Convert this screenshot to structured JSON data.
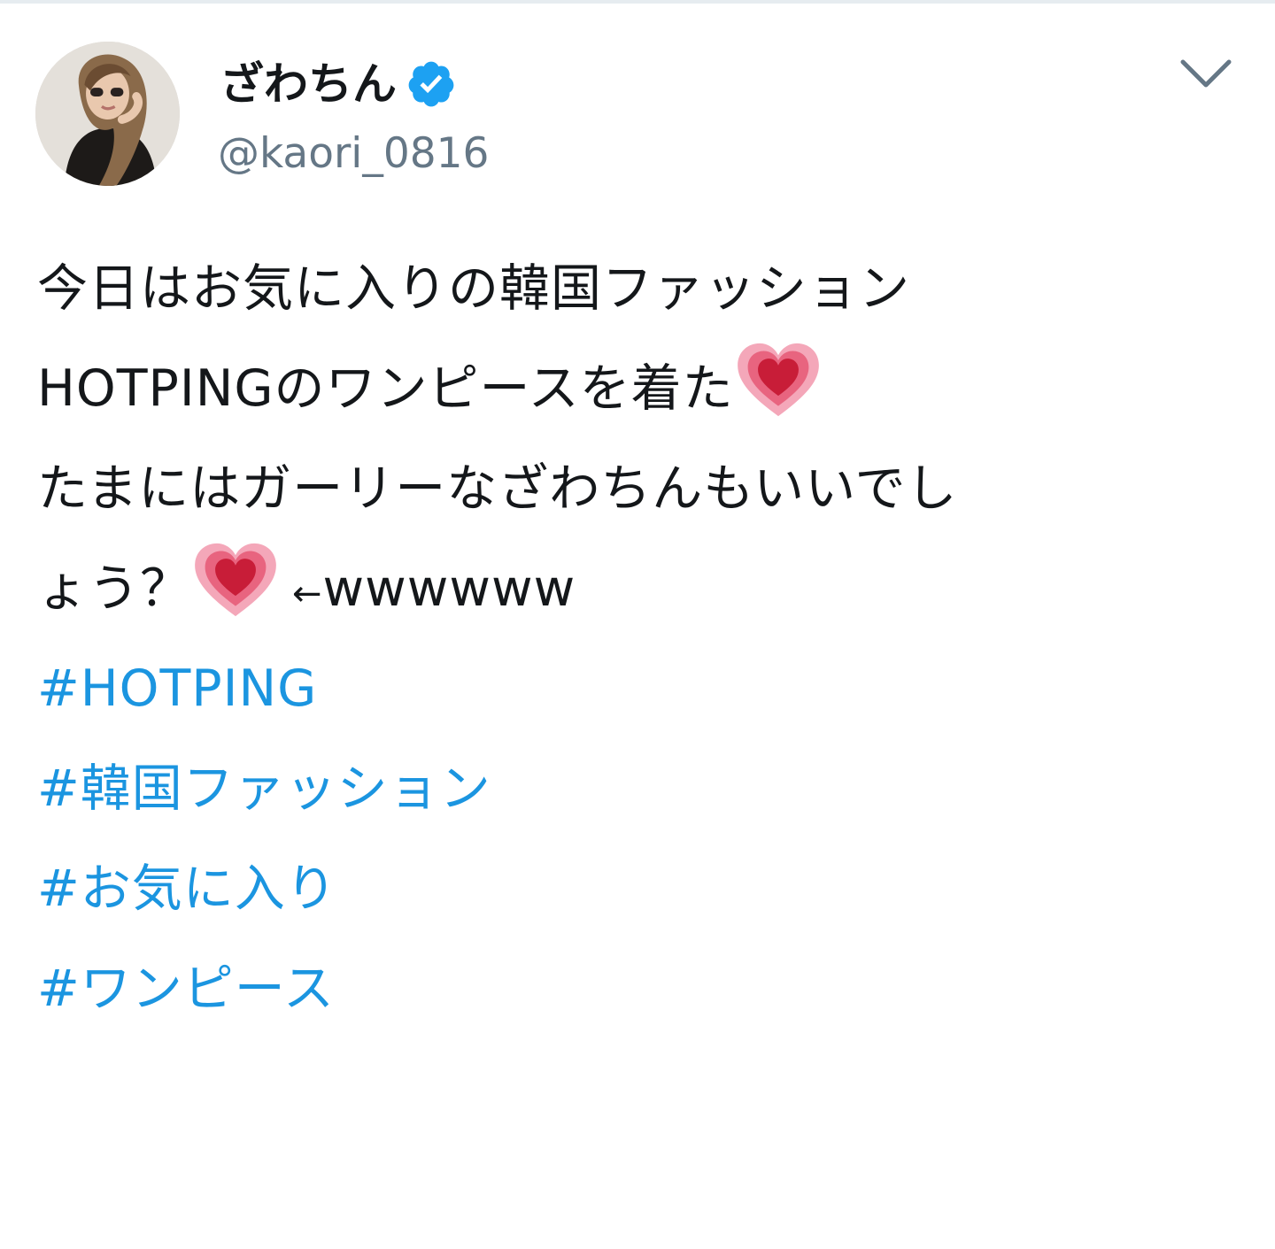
{
  "profile": {
    "display_name": "ざわちん",
    "handle": "@kaori_0816",
    "verified": true,
    "avatar_icon": "profile-photo"
  },
  "menu": {
    "icon": "chevron-down-icon"
  },
  "tweet": {
    "line1": "今日はお気に入りの韓国ファッション",
    "line2": "HOTPINGのワンピースを着た",
    "line3": "たまにはガーリーなざわちんもいいでし",
    "line4_text": "ょう？",
    "line4_arrow": "←",
    "line4_tail": "wwwwww",
    "emoji": "growing-heart-emoji",
    "hashtags": [
      "#HOTPING",
      "#韓国ファッション",
      "#お気に入り",
      "#ワンピース"
    ]
  },
  "colors": {
    "link": "#1b95e0",
    "text": "#14171a",
    "secondary": "#657786",
    "verified_badge": "#1da1f2"
  }
}
